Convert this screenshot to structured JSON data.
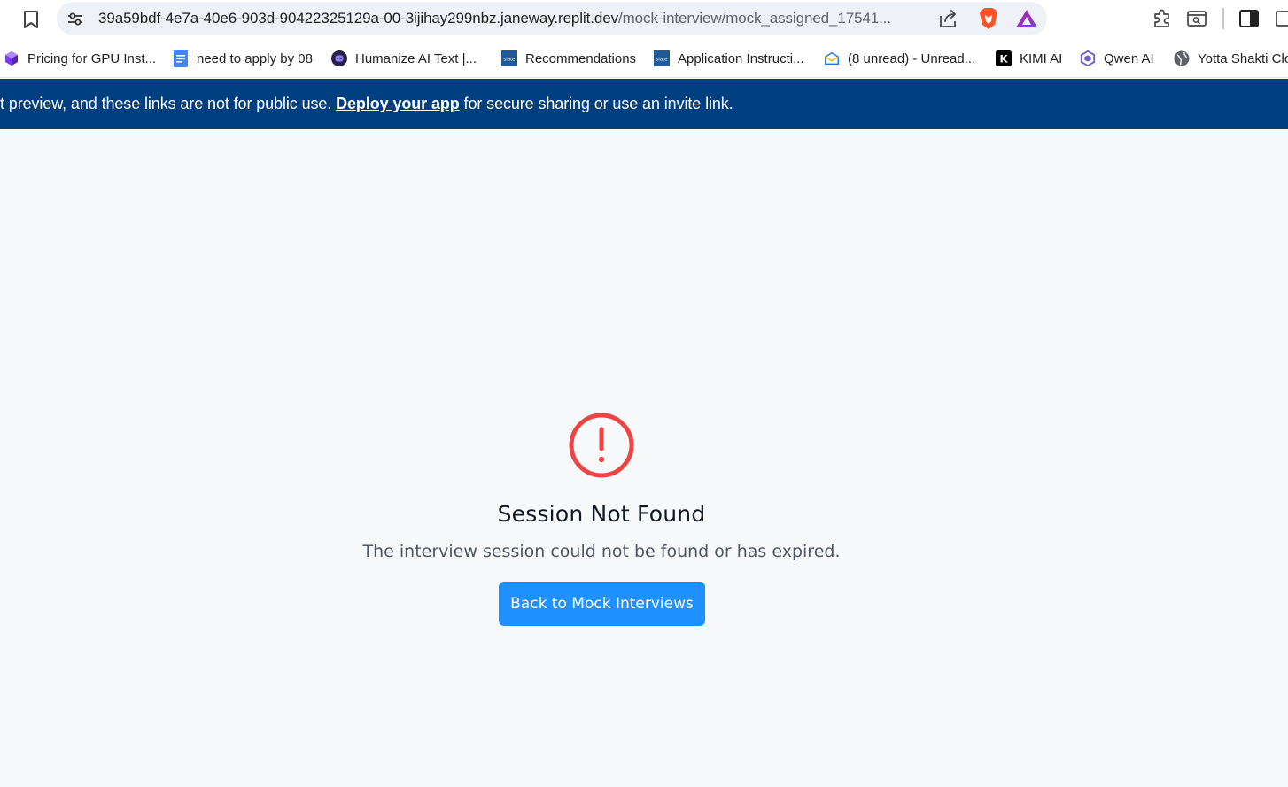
{
  "browser": {
    "url_host": "39a59bdf-4e7a-40e6-903d-90422325129a-00-3ijihay299nbz.janeway.replit.dev",
    "url_path": "/mock-interview/mock_assigned_17541..."
  },
  "bookmarks": [
    {
      "label": "Pricing for GPU Inst...",
      "icon": "cube-icon"
    },
    {
      "label": "need to apply by 08",
      "icon": "docs-icon"
    },
    {
      "label": "Humanize AI Text |...",
      "icon": "humanize-icon"
    },
    {
      "label": "Recommendations",
      "icon": "slate-icon"
    },
    {
      "label": "Application Instructi...",
      "icon": "slate-icon"
    },
    {
      "label": "(8 unread) - Unread...",
      "icon": "mail-icon"
    },
    {
      "label": "KIMI AI",
      "icon": "kimi-icon"
    },
    {
      "label": "Qwen AI",
      "icon": "qwen-icon"
    },
    {
      "label": "Yotta Shakti Clo",
      "icon": "globe-icon"
    }
  ],
  "banner": {
    "text_before": "t preview, and these links are not for public use. ",
    "link": "Deploy your app",
    "text_after": " for secure sharing or use an invite link."
  },
  "error": {
    "title": "Session Not Found",
    "description": "The interview session could not be found or has expired.",
    "button_label": "Back to Mock Interviews",
    "icon": "alert-circle-icon",
    "color": "#ef4444"
  },
  "colors": {
    "banner": "#003f7f",
    "button": "#1e90ff"
  }
}
